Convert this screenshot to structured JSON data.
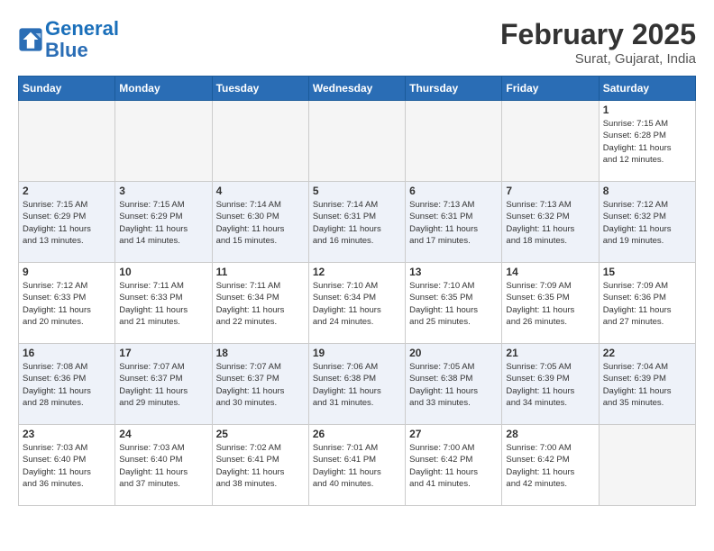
{
  "header": {
    "logo_line1": "General",
    "logo_line2": "Blue",
    "month_year": "February 2025",
    "location": "Surat, Gujarat, India"
  },
  "days_of_week": [
    "Sunday",
    "Monday",
    "Tuesday",
    "Wednesday",
    "Thursday",
    "Friday",
    "Saturday"
  ],
  "weeks": [
    [
      {
        "num": "",
        "info": ""
      },
      {
        "num": "",
        "info": ""
      },
      {
        "num": "",
        "info": ""
      },
      {
        "num": "",
        "info": ""
      },
      {
        "num": "",
        "info": ""
      },
      {
        "num": "",
        "info": ""
      },
      {
        "num": "1",
        "info": "Sunrise: 7:15 AM\nSunset: 6:28 PM\nDaylight: 11 hours\nand 12 minutes."
      }
    ],
    [
      {
        "num": "2",
        "info": "Sunrise: 7:15 AM\nSunset: 6:29 PM\nDaylight: 11 hours\nand 13 minutes."
      },
      {
        "num": "3",
        "info": "Sunrise: 7:15 AM\nSunset: 6:29 PM\nDaylight: 11 hours\nand 14 minutes."
      },
      {
        "num": "4",
        "info": "Sunrise: 7:14 AM\nSunset: 6:30 PM\nDaylight: 11 hours\nand 15 minutes."
      },
      {
        "num": "5",
        "info": "Sunrise: 7:14 AM\nSunset: 6:31 PM\nDaylight: 11 hours\nand 16 minutes."
      },
      {
        "num": "6",
        "info": "Sunrise: 7:13 AM\nSunset: 6:31 PM\nDaylight: 11 hours\nand 17 minutes."
      },
      {
        "num": "7",
        "info": "Sunrise: 7:13 AM\nSunset: 6:32 PM\nDaylight: 11 hours\nand 18 minutes."
      },
      {
        "num": "8",
        "info": "Sunrise: 7:12 AM\nSunset: 6:32 PM\nDaylight: 11 hours\nand 19 minutes."
      }
    ],
    [
      {
        "num": "9",
        "info": "Sunrise: 7:12 AM\nSunset: 6:33 PM\nDaylight: 11 hours\nand 20 minutes."
      },
      {
        "num": "10",
        "info": "Sunrise: 7:11 AM\nSunset: 6:33 PM\nDaylight: 11 hours\nand 21 minutes."
      },
      {
        "num": "11",
        "info": "Sunrise: 7:11 AM\nSunset: 6:34 PM\nDaylight: 11 hours\nand 22 minutes."
      },
      {
        "num": "12",
        "info": "Sunrise: 7:10 AM\nSunset: 6:34 PM\nDaylight: 11 hours\nand 24 minutes."
      },
      {
        "num": "13",
        "info": "Sunrise: 7:10 AM\nSunset: 6:35 PM\nDaylight: 11 hours\nand 25 minutes."
      },
      {
        "num": "14",
        "info": "Sunrise: 7:09 AM\nSunset: 6:35 PM\nDaylight: 11 hours\nand 26 minutes."
      },
      {
        "num": "15",
        "info": "Sunrise: 7:09 AM\nSunset: 6:36 PM\nDaylight: 11 hours\nand 27 minutes."
      }
    ],
    [
      {
        "num": "16",
        "info": "Sunrise: 7:08 AM\nSunset: 6:36 PM\nDaylight: 11 hours\nand 28 minutes."
      },
      {
        "num": "17",
        "info": "Sunrise: 7:07 AM\nSunset: 6:37 PM\nDaylight: 11 hours\nand 29 minutes."
      },
      {
        "num": "18",
        "info": "Sunrise: 7:07 AM\nSunset: 6:37 PM\nDaylight: 11 hours\nand 30 minutes."
      },
      {
        "num": "19",
        "info": "Sunrise: 7:06 AM\nSunset: 6:38 PM\nDaylight: 11 hours\nand 31 minutes."
      },
      {
        "num": "20",
        "info": "Sunrise: 7:05 AM\nSunset: 6:38 PM\nDaylight: 11 hours\nand 33 minutes."
      },
      {
        "num": "21",
        "info": "Sunrise: 7:05 AM\nSunset: 6:39 PM\nDaylight: 11 hours\nand 34 minutes."
      },
      {
        "num": "22",
        "info": "Sunrise: 7:04 AM\nSunset: 6:39 PM\nDaylight: 11 hours\nand 35 minutes."
      }
    ],
    [
      {
        "num": "23",
        "info": "Sunrise: 7:03 AM\nSunset: 6:40 PM\nDaylight: 11 hours\nand 36 minutes."
      },
      {
        "num": "24",
        "info": "Sunrise: 7:03 AM\nSunset: 6:40 PM\nDaylight: 11 hours\nand 37 minutes."
      },
      {
        "num": "25",
        "info": "Sunrise: 7:02 AM\nSunset: 6:41 PM\nDaylight: 11 hours\nand 38 minutes."
      },
      {
        "num": "26",
        "info": "Sunrise: 7:01 AM\nSunset: 6:41 PM\nDaylight: 11 hours\nand 40 minutes."
      },
      {
        "num": "27",
        "info": "Sunrise: 7:00 AM\nSunset: 6:42 PM\nDaylight: 11 hours\nand 41 minutes."
      },
      {
        "num": "28",
        "info": "Sunrise: 7:00 AM\nSunset: 6:42 PM\nDaylight: 11 hours\nand 42 minutes."
      },
      {
        "num": "",
        "info": ""
      }
    ]
  ]
}
